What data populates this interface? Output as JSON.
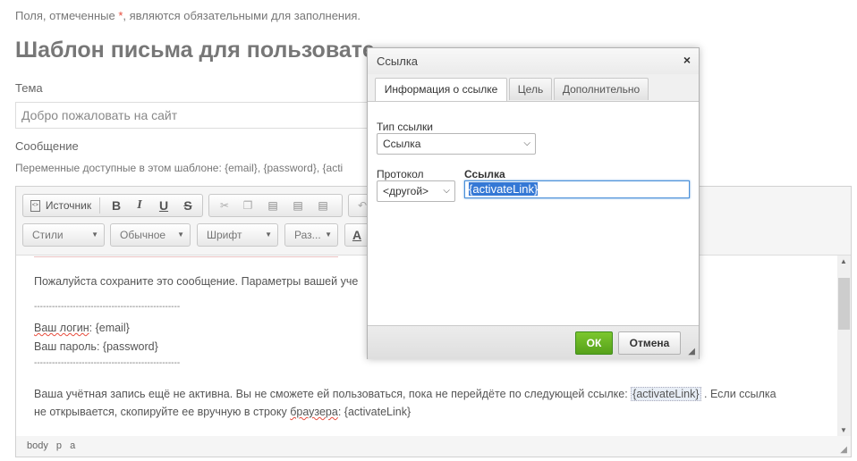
{
  "page": {
    "required_note_pre": "Поля, отмеченные ",
    "required_star": "*",
    "required_note_post": ", являются обязательными для заполнения.",
    "title": "Шаблон письма для пользовате",
    "subject_label": "Тема",
    "subject_value": "Добро пожаловать на сайт",
    "message_label": "Сообщение",
    "vars_line": "Переменные доступные в этом шаблоне: {email}, {password}, {acti"
  },
  "toolbar": {
    "source_label": "Источник",
    "bold": "B",
    "italic": "I",
    "underline": "U",
    "strike": "S",
    "styles_combo": "Стили",
    "format_combo": "Обычное",
    "font_combo": "Шрифт",
    "size_combo": "Раз...",
    "text_color": "A"
  },
  "editor": {
    "line1": "Пожалуйста сохраните это сообщение. Параметры вашей уче",
    "separator": "-------------------------------------------------",
    "login_label": "Ваш логин",
    "login_value": ": {email}",
    "password_line": "Ваш пароль: {password}",
    "activation_text": "Ваша учётная запись ещё не активна. Вы не сможете ей пользоваться, пока не перейдёте по следующей ссылке:  ",
    "activation_chip": "{activateLink}",
    "activation_tail": " . Если ссылка",
    "line_last_pre": "не открывается, скопируйте ее вручную в строку ",
    "line_last_word": "браузера",
    "line_last_post": ":  {activateLink}",
    "path": "body p a"
  },
  "dialog": {
    "title": "Ссылка",
    "close": "×",
    "tabs": [
      {
        "label": "Информация о ссылке"
      },
      {
        "label": "Цель"
      },
      {
        "label": "Дополнительно"
      }
    ],
    "link_type_label": "Тип ссылки",
    "link_type_value": "Ссылка",
    "protocol_label": "Протокол",
    "protocol_value": "<другой>",
    "url_label": "Ссылка",
    "url_value": "{activateLink}",
    "ok_label": "ОК",
    "cancel_label": "Отмена"
  },
  "colors": {
    "ok_green": "#6cb625",
    "focus_blue": "#4a90d9",
    "required_red": "#e74c3c"
  }
}
